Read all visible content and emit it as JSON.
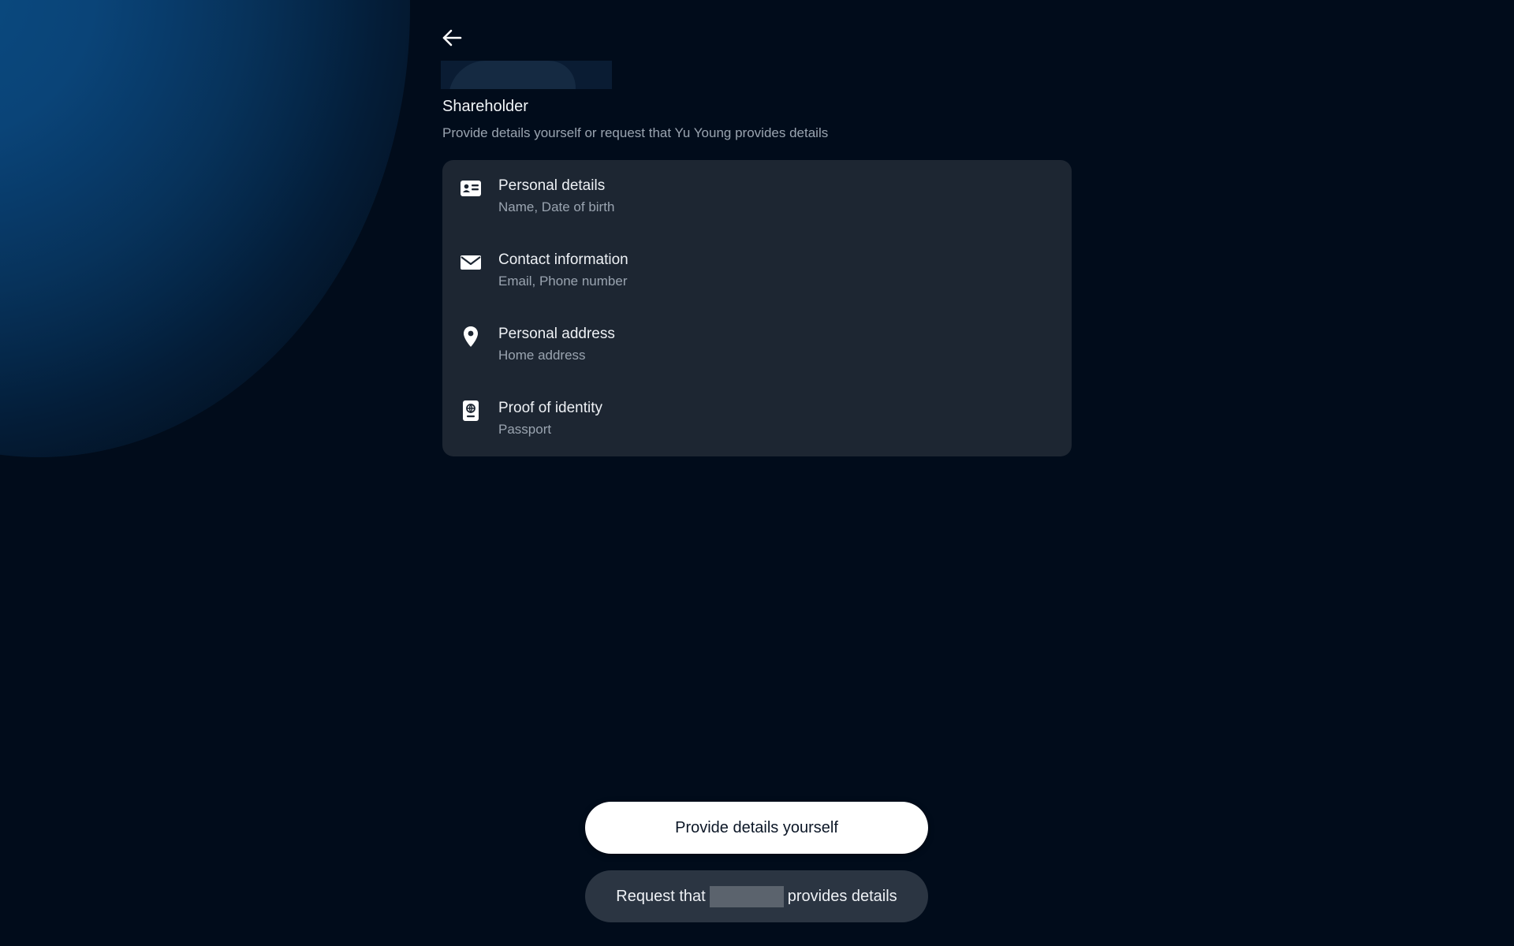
{
  "header": {
    "back_icon": "arrow-left-icon"
  },
  "page": {
    "title": "Shareholder",
    "subtitle": "Provide details yourself or request that Yu Young provides details"
  },
  "requirements": [
    {
      "icon": "id-card-icon",
      "label": "Personal details",
      "description": "Name, Date of birth"
    },
    {
      "icon": "envelope-icon",
      "label": "Contact information",
      "description": "Email, Phone number"
    },
    {
      "icon": "map-pin-icon",
      "label": "Personal address",
      "description": "Home address"
    },
    {
      "icon": "passport-icon",
      "label": "Proof of identity",
      "description": "Passport"
    }
  ],
  "actions": {
    "primary_label": "Provide details yourself",
    "secondary_prefix": "Request that",
    "secondary_suffix": "provides details"
  },
  "colors": {
    "background": "#010c1b",
    "card": "#1d2632",
    "primary_button": "#ffffff",
    "secondary_button": "#2b3542",
    "muted_text": "#9aa4b0"
  }
}
